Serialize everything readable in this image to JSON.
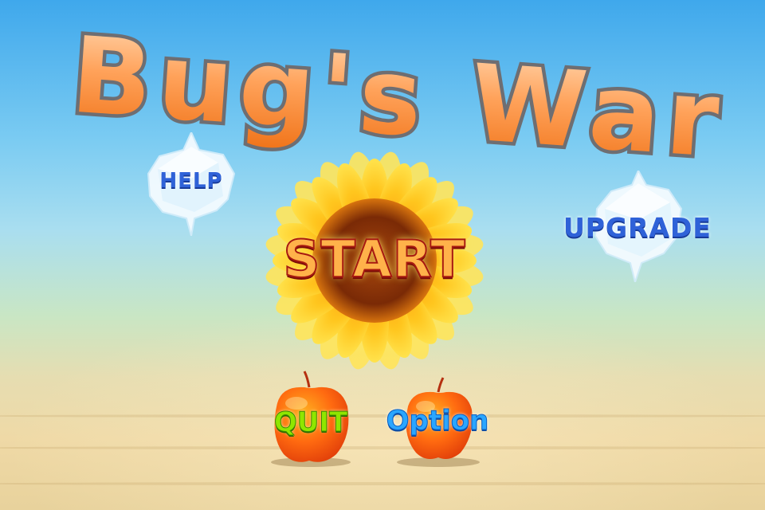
{
  "game": {
    "title": "Bug's War"
  },
  "menu": {
    "start_label": "START",
    "help_label": "HELP",
    "upgrade_label": "UPGRADE",
    "quit_label": "QUIT",
    "option_label": "Option"
  },
  "palette": {
    "sky_top": "#3fa8ec",
    "sky_mid": "#a9def0",
    "ground": "#e8d29c",
    "title_fill": "#ff9a4a",
    "title_outline": "#6f6f73",
    "petal": "#ffc21a",
    "flower_center": "#7a2a06",
    "apple": "#ff6a10",
    "crystal": "#eef8ff"
  },
  "icons": {
    "flower": "sunflower-icon",
    "apple": "apple-icon",
    "crystal": "crystal-icon"
  }
}
